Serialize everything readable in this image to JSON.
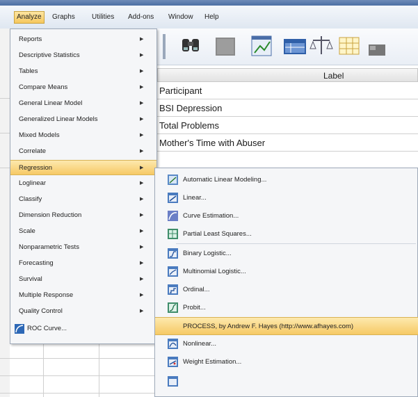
{
  "menubar": {
    "items": [
      {
        "label": "Analyze"
      },
      {
        "label": "Graphs"
      },
      {
        "label": "Utilities"
      },
      {
        "label": "Add-ons"
      },
      {
        "label": "Window"
      },
      {
        "label": "Help"
      }
    ]
  },
  "grid": {
    "header_label": "Label",
    "rows": [
      "Participant",
      "BSI Depression",
      "Total Problems",
      "Mother's Time with Abuser",
      ""
    ]
  },
  "analyze_menu": {
    "items": [
      {
        "label": "Reports",
        "submenu": true
      },
      {
        "label": "Descriptive Statistics",
        "submenu": true
      },
      {
        "label": "Tables",
        "submenu": true
      },
      {
        "label": "Compare Means",
        "submenu": true
      },
      {
        "label": "General Linear Model",
        "submenu": true
      },
      {
        "label": "Generalized Linear Models",
        "submenu": true
      },
      {
        "label": "Mixed Models",
        "submenu": true
      },
      {
        "label": "Correlate",
        "submenu": true
      },
      {
        "label": "Regression",
        "submenu": true
      },
      {
        "label": "Loglinear",
        "submenu": true
      },
      {
        "label": "Classify",
        "submenu": true
      },
      {
        "label": "Dimension Reduction",
        "submenu": true
      },
      {
        "label": "Scale",
        "submenu": true
      },
      {
        "label": "Nonparametric Tests",
        "submenu": true
      },
      {
        "label": "Forecasting",
        "submenu": true
      },
      {
        "label": "Survival",
        "submenu": true
      },
      {
        "label": "Multiple Response",
        "submenu": true
      },
      {
        "label": "Quality Control",
        "submenu": true
      },
      {
        "label": "ROC Curve...",
        "submenu": false
      }
    ],
    "highlighted": "Regression"
  },
  "regression_submenu": {
    "items": [
      {
        "label": "Automatic Linear Modeling...",
        "icon": "automatic-linear-modeling-icon"
      },
      {
        "label": "Linear...",
        "icon": "linear-regression-icon"
      },
      {
        "label": "Curve Estimation...",
        "icon": "curve-estimation-icon"
      },
      {
        "label": "Partial Least Squares...",
        "icon": "partial-least-squares-icon"
      },
      {
        "label": "Binary Logistic...",
        "icon": "binary-logistic-icon"
      },
      {
        "label": "Multinomial Logistic...",
        "icon": "multinomial-logistic-icon"
      },
      {
        "label": "Ordinal...",
        "icon": "ordinal-icon"
      },
      {
        "label": "Probit...",
        "icon": "probit-icon"
      },
      {
        "label": "PROCESS, by Andrew F. Hayes (http://www.afhayes.com)",
        "icon": ""
      },
      {
        "label": "Nonlinear...",
        "icon": "nonlinear-icon"
      },
      {
        "label": "Weight Estimation...",
        "icon": "weight-estimation-icon"
      }
    ],
    "highlighted": "PROCESS, by Andrew F. Hayes (http://www.afhayes.com)"
  },
  "colors": {
    "highlight": "#f6c965",
    "menu_bg": "#f5f6f8",
    "menubar_bg": "#dfe7f1"
  }
}
